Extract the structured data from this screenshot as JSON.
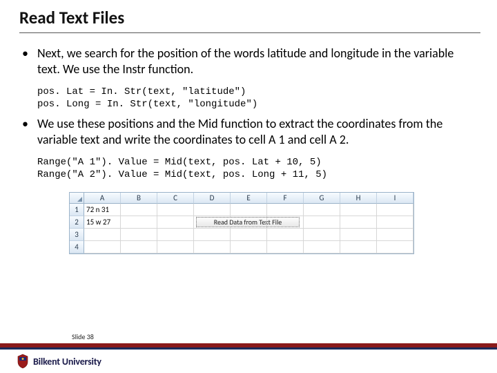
{
  "title": "Read Text Files",
  "bullet1": "Next, we search for the position of the words latitude and longitude in the variable text. We use the Instr function.",
  "code1_line1": "pos. Lat = In. Str(text, \"latitude\")",
  "code1_line2": "pos. Long = In. Str(text, \"longitude\")",
  "bullet2": "We use these positions and the Mid function to extract the coordinates from the variable text and write the coordinates to cell A 1 and cell A 2.",
  "code2_line1": "Range(\"A 1\"). Value = Mid(text, pos. Lat + 10, 5)",
  "code2_line2": "Range(\"A 2\"). Value = Mid(text, pos. Long + 11, 5)",
  "sheet": {
    "cols": [
      "A",
      "B",
      "C",
      "D",
      "E",
      "F",
      "G",
      "H",
      "I"
    ],
    "rows": [
      "1",
      "2",
      "3",
      "4"
    ],
    "a1": "72 n 31",
    "a2": "15 w 27",
    "button": "Read Data from Text File"
  },
  "slide_label": "Slide 38",
  "university": "Bilkent University"
}
